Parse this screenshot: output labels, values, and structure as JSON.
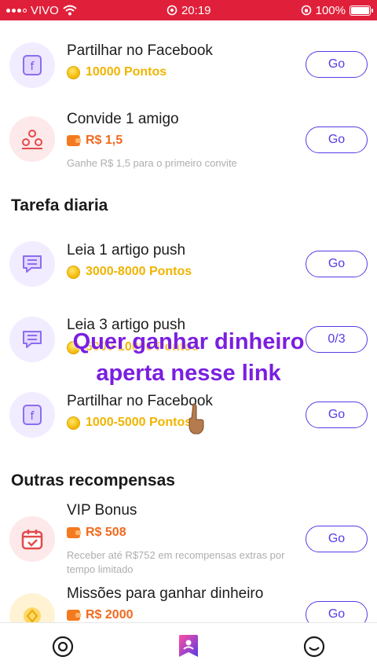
{
  "status_bar": {
    "carrier": "VIVO",
    "time": "20:19",
    "battery": "100%"
  },
  "tasks_top": [
    {
      "title": "Partilhar no Facebook",
      "reward": "10000 Pontos",
      "reward_type": "coin",
      "icon": "facebook-icon",
      "button": "Go"
    },
    {
      "title": "Convide 1 amigo",
      "reward": "R$ 1,5",
      "reward_type": "money",
      "icon": "invite-friends-icon",
      "desc": "Ganhe R$ 1,5 para o primeiro convite",
      "button": "Go"
    }
  ],
  "daily": {
    "heading": "Tarefa diaria",
    "tasks": [
      {
        "title": "Leia 1 artigo push",
        "reward": "3000-8000 Pontos",
        "reward_type": "coin",
        "icon": "message-icon",
        "button": "Go"
      },
      {
        "title": "Leia 3 artigo push",
        "reward": "5000-10000 Pontos",
        "reward_type": "coin",
        "icon": "message-icon",
        "button": "0/3"
      },
      {
        "title": "Partilhar no Facebook",
        "reward": "1000-5000 Pontos",
        "reward_type": "coin",
        "icon": "facebook-icon",
        "button": "Go"
      }
    ]
  },
  "others": {
    "heading": "Outras recompensas",
    "tasks": [
      {
        "title": "VIP Bonus",
        "reward": "R$ 508",
        "reward_type": "money",
        "icon": "calendar-check-icon",
        "desc": "Receber até R$752 em recompensas extras por tempo limitado",
        "button": "Go"
      },
      {
        "title": "Missões para ganhar dinheiro",
        "reward": "R$ 2000",
        "reward_type": "money",
        "icon": "diamond-icon",
        "button": "Go"
      }
    ]
  },
  "overlay": {
    "line1": "Quer ganhar dinheiro",
    "line2": "aperta nesse link"
  },
  "tabbar": {
    "tabs": [
      "home-tab",
      "tasks-tab",
      "profile-tab"
    ],
    "active": "tasks-tab"
  },
  "colors": {
    "status_bar": "#e0203a",
    "accent": "#5a39e6",
    "coin": "#f0b400",
    "money": "#f06a1e",
    "overlay": "#7a1ee0"
  }
}
